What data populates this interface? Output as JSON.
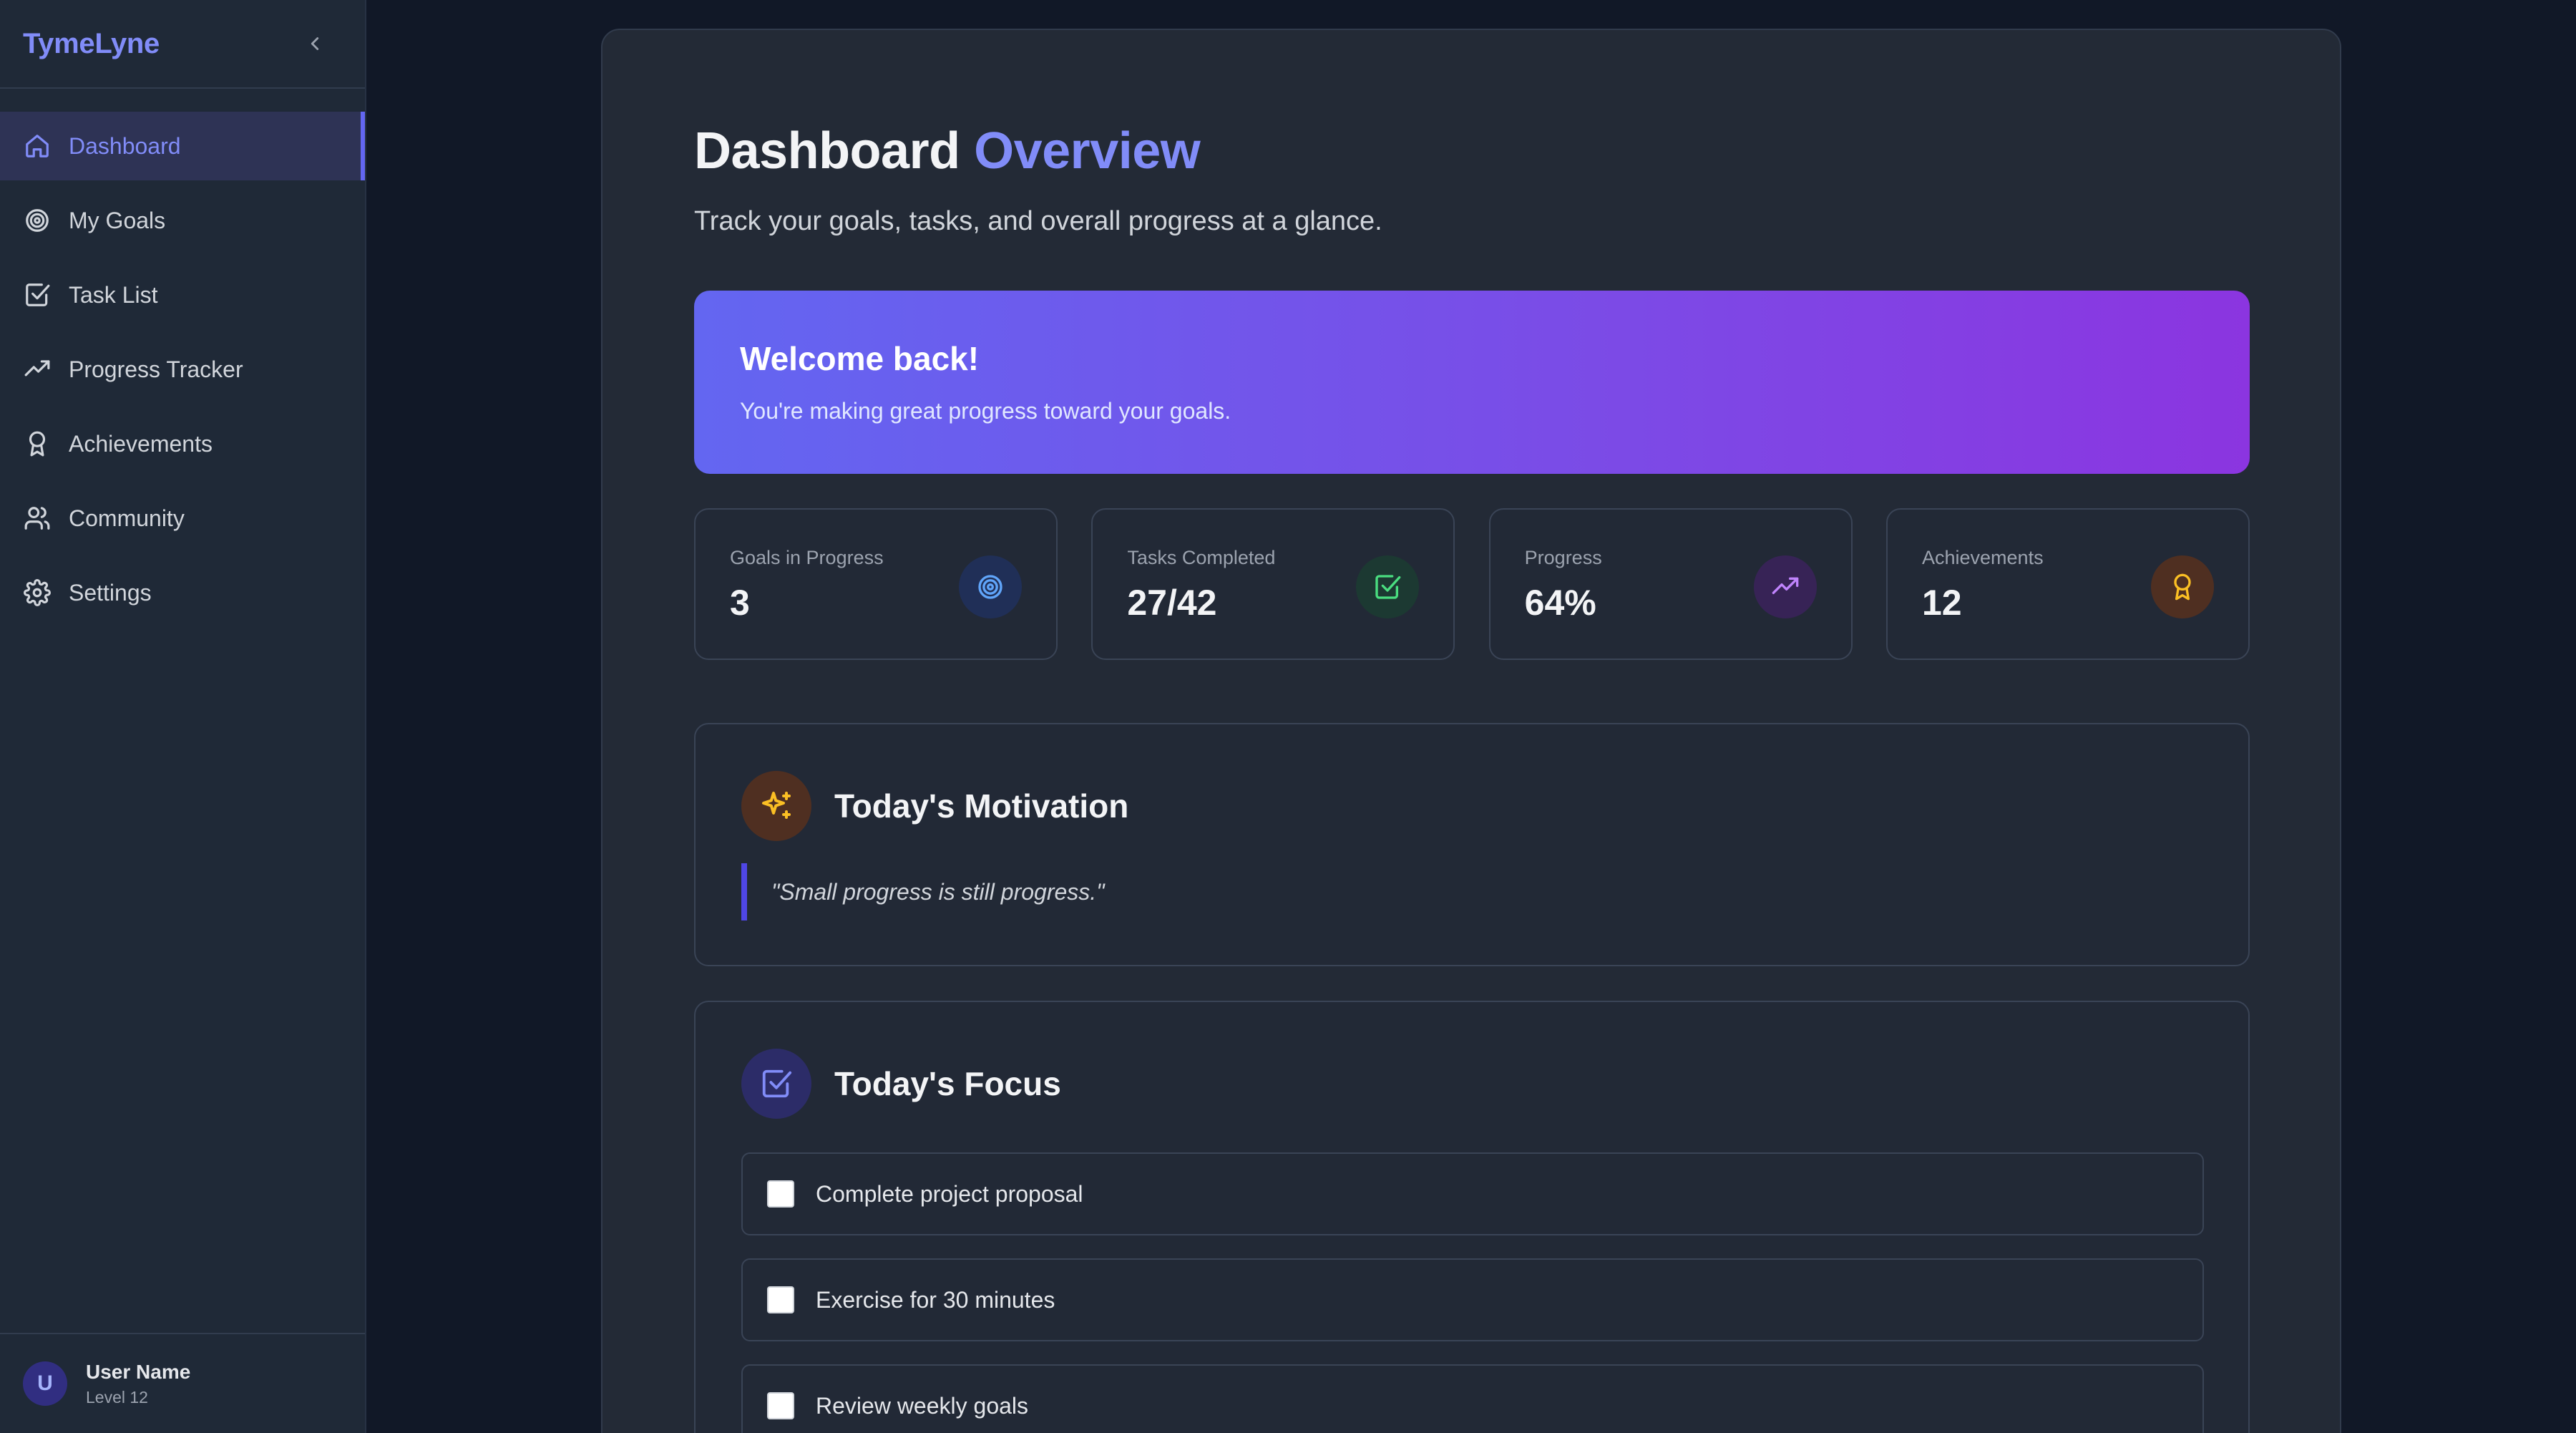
{
  "app": {
    "brand": "TymeLyne"
  },
  "sidebar": {
    "items": [
      {
        "label": "Dashboard",
        "icon": "home-icon",
        "active": true
      },
      {
        "label": "My Goals",
        "icon": "target-icon"
      },
      {
        "label": "Task List",
        "icon": "checkbox-icon"
      },
      {
        "label": "Progress Tracker",
        "icon": "trending-up-icon"
      },
      {
        "label": "Achievements",
        "icon": "award-icon"
      },
      {
        "label": "Community",
        "icon": "users-icon"
      },
      {
        "label": "Settings",
        "icon": "gear-icon"
      }
    ],
    "user": {
      "initial": "U",
      "name": "User Name",
      "level": "Level 12"
    }
  },
  "header": {
    "title_main": "Dashboard",
    "title_accent": "Overview",
    "subtitle": "Track your goals, tasks, and overall progress at a glance."
  },
  "welcome": {
    "title": "Welcome back!",
    "message": "You're making great progress toward your goals."
  },
  "stats": [
    {
      "label": "Goals in Progress",
      "value": "3",
      "icon": "target-icon",
      "color": "#3b82f6"
    },
    {
      "label": "Tasks Completed",
      "value": "27/42",
      "icon": "check-square-icon",
      "color": "#22c55e"
    },
    {
      "label": "Progress",
      "value": "64%",
      "icon": "trending-up-icon",
      "color": "#a855f7"
    },
    {
      "label": "Achievements",
      "value": "12",
      "icon": "award-icon",
      "color": "#f59e0b"
    }
  ],
  "motivation": {
    "title": "Today's Motivation",
    "quote": "\"Small progress is still progress.\"",
    "icon": "sparkles-icon"
  },
  "focus": {
    "title": "Today's Focus",
    "icon": "check-square-icon",
    "tasks": [
      {
        "label": "Complete project proposal",
        "checked": false
      },
      {
        "label": "Exercise for 30 minutes",
        "checked": false
      },
      {
        "label": "Review weekly goals",
        "checked": false
      }
    ]
  },
  "colors": {
    "accent": "#818cf8",
    "sidebar_bg": "#1f2937",
    "panel_bg": "#232a36",
    "page_bg": "#111827"
  }
}
